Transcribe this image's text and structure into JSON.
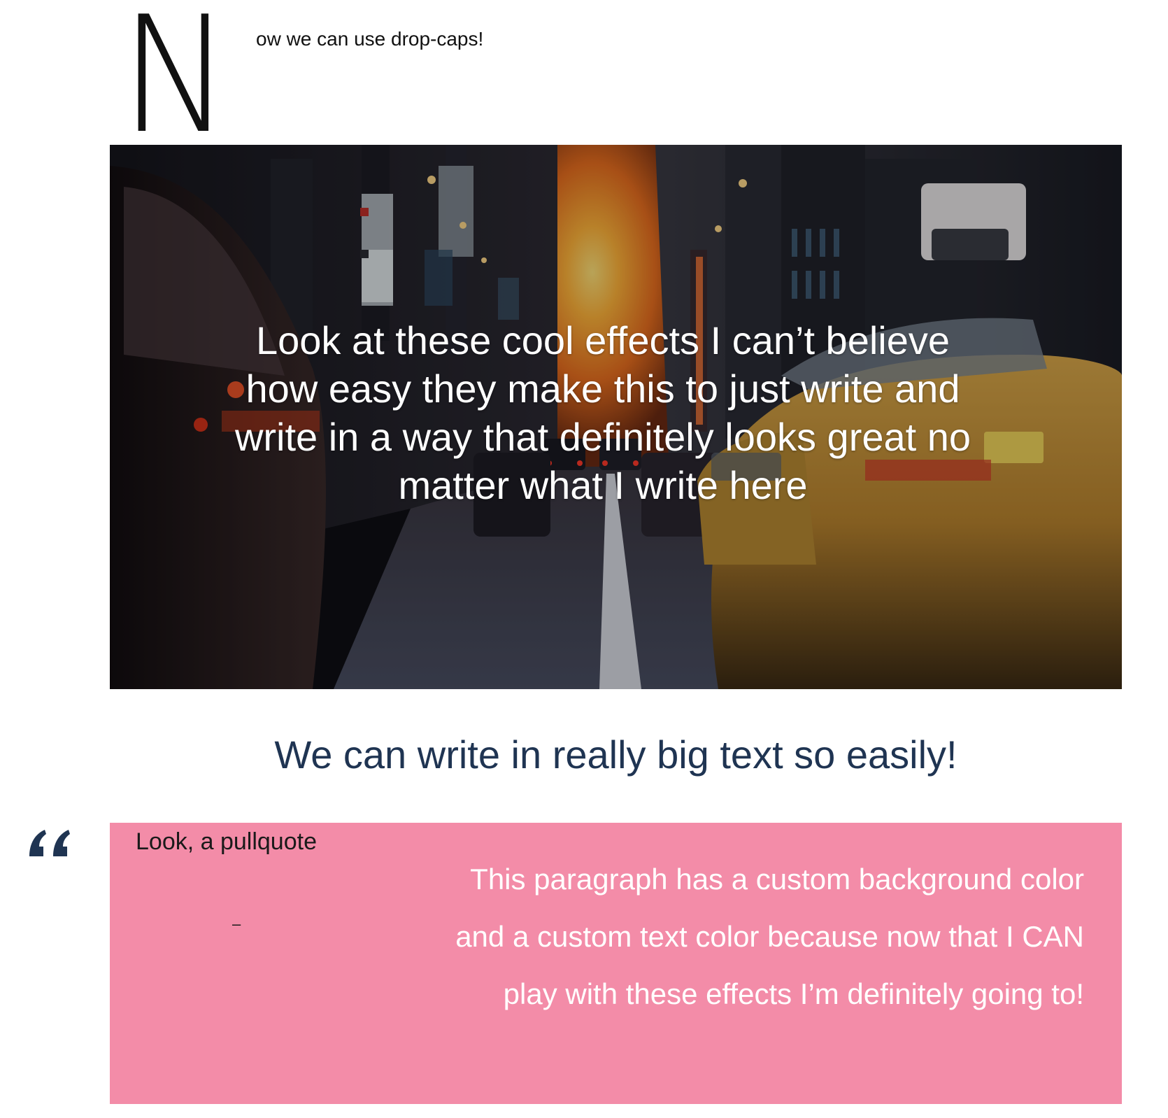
{
  "dropcap": {
    "letter": "N",
    "rest": "ow we can use drop-caps!"
  },
  "cover": {
    "image_icon": "city-street-sunset-image",
    "text": "Look at these cool effects I can’t believe how easy they make this to just write and write in a way that definitely looks great no matter what I write here"
  },
  "heading": {
    "text": "We can write in really big text so easily!"
  },
  "pullquote": {
    "icon": "quote-icon",
    "label": "Look, a pullquote",
    "dash": "–"
  },
  "custom_paragraph": {
    "text": "This paragraph has a custom background color and a custom text color because now that I CAN play with these effects I’m definitely going to!",
    "background_color": "#f38ca8",
    "text_color": "#ffffff"
  },
  "colors": {
    "heading": "#1f3452",
    "quote_mark": "#1f3452"
  }
}
